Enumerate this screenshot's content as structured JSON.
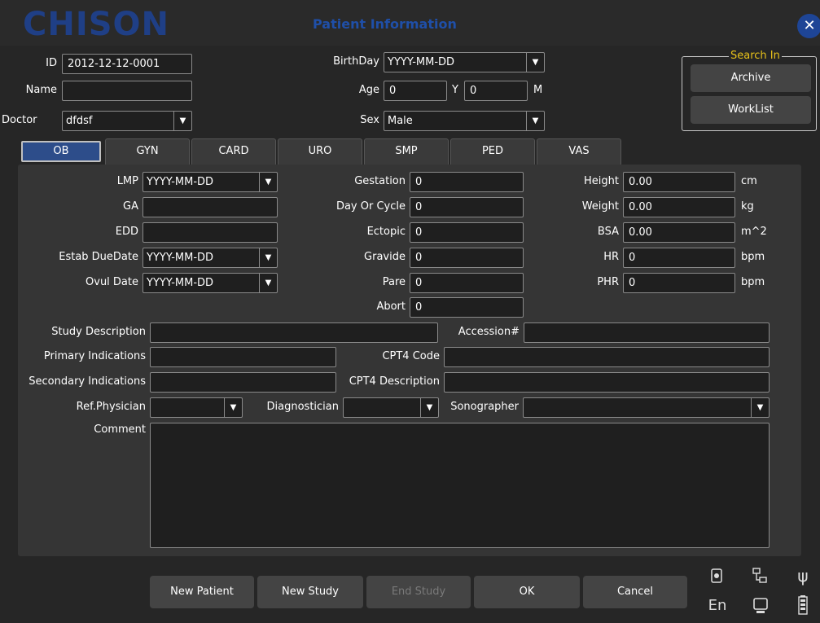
{
  "app": {
    "logo": "CHISON",
    "title": "Patient Information",
    "close_icon": "close-icon"
  },
  "patient": {
    "id_label": "ID",
    "id_value": "2012-12-12-0001",
    "name_label": "Name",
    "name_value": "",
    "doctor_label": "Doctor",
    "doctor_value": "dfdsf",
    "birthday_label": "BirthDay",
    "birthday_value": "YYYY-MM-DD",
    "age_label": "Age",
    "age_years": "0",
    "age_y_unit": "Y",
    "age_months": "0",
    "age_m_unit": "M",
    "sex_label": "Sex",
    "sex_value": "Male"
  },
  "search": {
    "label": "Search In",
    "archive": "Archive",
    "worklist": "WorkList"
  },
  "tabs": [
    "OB",
    "GYN",
    "CARD",
    "URO",
    "SMP",
    "PED",
    "VAS"
  ],
  "ob": {
    "lmp_label": "LMP",
    "lmp_value": "YYYY-MM-DD",
    "ga_label": "GA",
    "ga_value": "",
    "edd_label": "EDD",
    "edd_value": "",
    "estab_label": "Estab DueDate",
    "estab_value": "YYYY-MM-DD",
    "ovul_label": "Ovul Date",
    "ovul_value": "YYYY-MM-DD",
    "gestation_label": "Gestation",
    "gestation_value": "0",
    "cycle_label": "Day Or Cycle",
    "cycle_value": "0",
    "ectopic_label": "Ectopic",
    "ectopic_value": "0",
    "gravide_label": "Gravide",
    "gravide_value": "0",
    "pare_label": "Pare",
    "pare_value": "0",
    "abort_label": "Abort",
    "abort_value": "0",
    "height_label": "Height",
    "height_value": "0.00",
    "height_unit": "cm",
    "weight_label": "Weight",
    "weight_value": "0.00",
    "weight_unit": "kg",
    "bsa_label": "BSA",
    "bsa_value": "0.00",
    "bsa_unit": "m^2",
    "hr_label": "HR",
    "hr_value": "0",
    "hr_unit": "bpm",
    "phr_label": "PHR",
    "phr_value": "0",
    "phr_unit": "bpm"
  },
  "study": {
    "desc_label": "Study Description",
    "desc_value": "",
    "accession_label": "Accession#",
    "accession_value": "",
    "primary_label": "Primary Indications",
    "primary_value": "",
    "cpt4code_label": "CPT4 Code",
    "cpt4code_value": "",
    "secondary_label": "Secondary Indications",
    "secondary_value": "",
    "cpt4desc_label": "CPT4 Description",
    "cpt4desc_value": "",
    "refphys_label": "Ref.Physician",
    "refphys_value": "",
    "diag_label": "Diagnostician",
    "diag_value": "",
    "sono_label": "Sonographer",
    "sono_value": "",
    "comment_label": "Comment",
    "comment_value": ""
  },
  "buttons": {
    "new_patient": "New Patient",
    "new_study": "New Study",
    "end_study": "End Study",
    "ok": "OK",
    "cancel": "Cancel"
  },
  "status": {
    "lang": "En",
    "icons": [
      "disk-icon",
      "network-icon",
      "usb-icon",
      "monitor-icon",
      "battery-icon"
    ]
  },
  "colors": {
    "accent": "#1f4fa8",
    "search_label": "#e8c21a",
    "active_tab": "#2d4d8a"
  }
}
